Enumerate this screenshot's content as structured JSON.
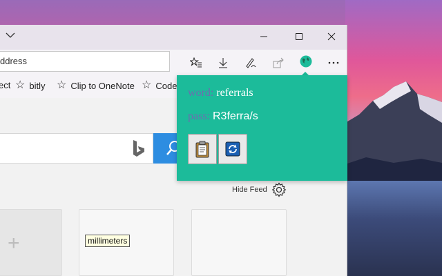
{
  "browser": {
    "address_text": "ddress",
    "favorites": [
      "ect",
      "bitly",
      "Clip to OneNote",
      "Code"
    ],
    "hide_feed_label": "Hide Feed",
    "tooltip": "millimeters"
  },
  "popup": {
    "word_label": "word:",
    "word_value": "referrals",
    "pass_label": "pass:",
    "pass_value": "R3ferra/s",
    "accent_color": "#1cbb9a"
  },
  "icons": {
    "toolbar": [
      "favorites-star-icon",
      "download-icon",
      "pen-icon",
      "share-icon",
      "extension-globe-icon",
      "more-icon"
    ],
    "window": [
      "minimize-icon",
      "maximize-icon",
      "close-icon"
    ]
  }
}
